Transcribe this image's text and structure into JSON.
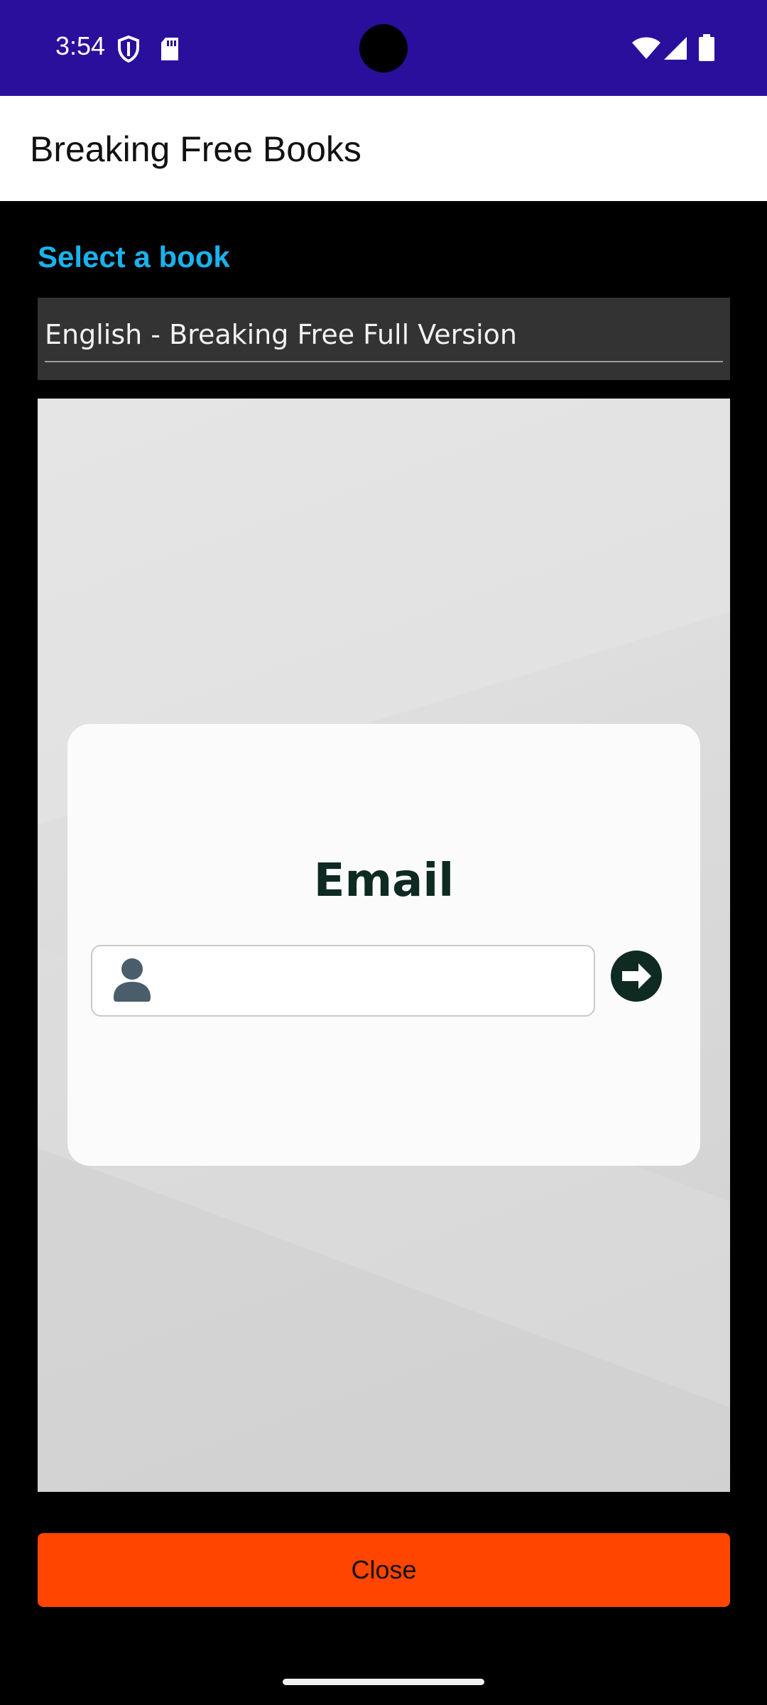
{
  "status_bar": {
    "time": "3:54",
    "left_icons": [
      "shield-icon",
      "sd-card-icon"
    ],
    "right_icons": [
      "wifi-icon",
      "cellular-signal-icon",
      "battery-icon"
    ],
    "background_color": "#2a0f9c"
  },
  "app_bar": {
    "title": "Breaking Free Books"
  },
  "book_selector": {
    "label": "Select a book",
    "selected_value": "English - Breaking Free Full Version",
    "label_color": "#1ab2ec"
  },
  "email_card": {
    "title": "Email",
    "input_value": "",
    "input_icon": "user-icon",
    "submit_icon": "arrow-right-circle-icon"
  },
  "footer": {
    "close_label": "Close",
    "close_color": "#ff4500"
  }
}
